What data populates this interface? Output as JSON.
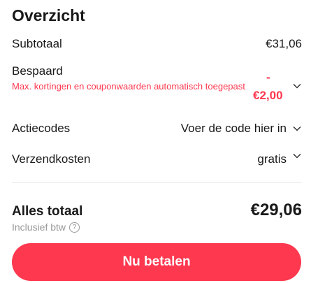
{
  "summary": {
    "title": "Overzicht",
    "subtotal": {
      "label": "Subtotaal",
      "value": "€31,06"
    },
    "savings": {
      "label": "Bespaard",
      "note": "Max. kortingen en couponwaarden automatisch toegepast",
      "sign": "-",
      "value": "€2,00",
      "color": "#fd384f"
    },
    "promo": {
      "label": "Actiecodes",
      "value": "Voer de code hier in"
    },
    "shipping": {
      "label": "Verzendkosten",
      "value": "gratis"
    },
    "total": {
      "label": "Alles totaal",
      "value": "€29,06"
    },
    "tax_note": "Inclusief btw",
    "help_icon": "?",
    "pay_button": "Nu betalen",
    "accent_color": "#fd384f"
  }
}
